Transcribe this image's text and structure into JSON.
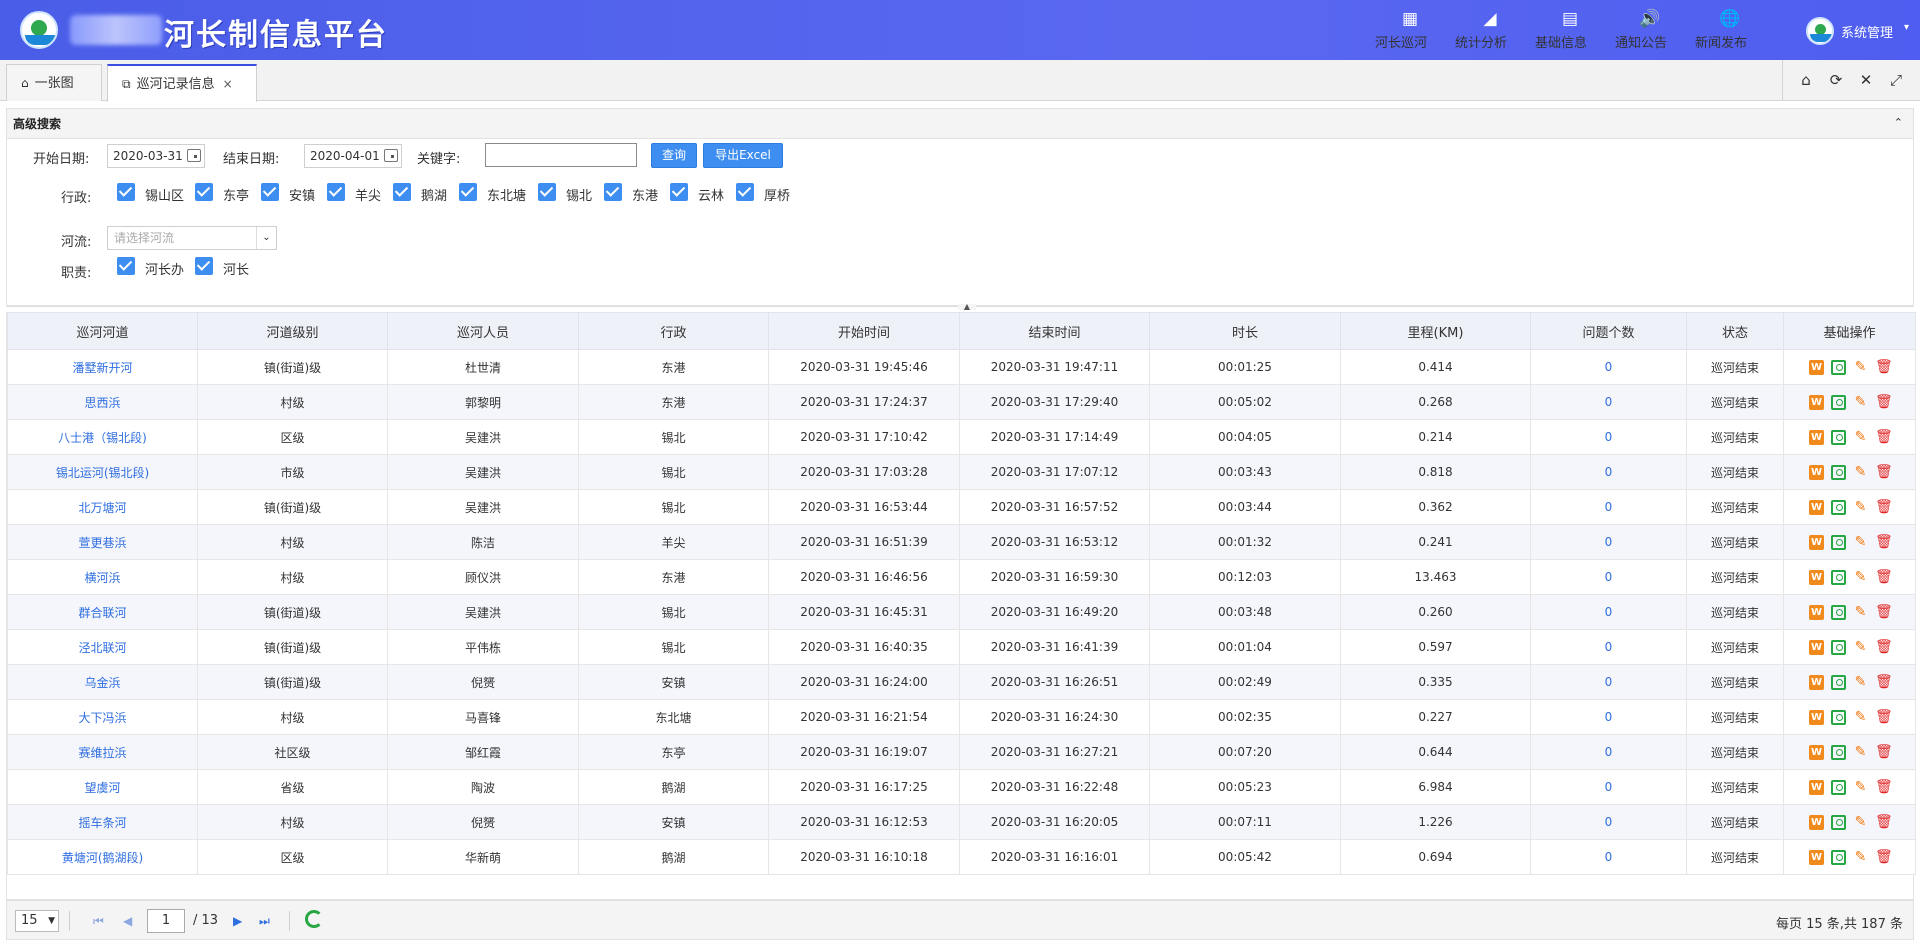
{
  "header": {
    "title": "河长制信息平台",
    "nav": [
      {
        "icon": "grid-table-icon",
        "glyph": "▦",
        "label": "河长巡河"
      },
      {
        "icon": "area-chart-icon",
        "glyph": "◢",
        "label": "统计分析"
      },
      {
        "icon": "id-card-icon",
        "glyph": "▤",
        "label": "基础信息"
      },
      {
        "icon": "speaker-icon",
        "glyph": "🔊",
        "label": "通知公告"
      },
      {
        "icon": "globe-icon",
        "glyph": "🌐",
        "label": "新闻发布"
      }
    ],
    "system_label": "系统管理"
  },
  "tabs": [
    {
      "icon": "home-icon",
      "label": "一张图"
    },
    {
      "icon": "window-icon",
      "label": "巡河记录信息",
      "close": "×"
    }
  ],
  "tools": [
    {
      "name": "home-tool-icon",
      "glyph": "⌂"
    },
    {
      "name": "refresh-tool-icon",
      "glyph": "⟳"
    },
    {
      "name": "close-tool-icon",
      "glyph": "✕"
    },
    {
      "name": "fullscreen-tool-icon",
      "glyph": "⤢"
    }
  ],
  "search": {
    "title": "高级搜索",
    "collapse_glyph": "⌃",
    "start_label": "开始日期:",
    "start_value": "2020-03-31",
    "end_label": "结束日期:",
    "end_value": "2020-04-01",
    "keyword_label": "关键字:",
    "keyword_value": "",
    "query_label": "查询",
    "export_label": "导出Excel",
    "admin_label": "行政:",
    "admin_options": [
      "锡山区",
      "东亭",
      "安镇",
      "羊尖",
      "鹅湖",
      "东北塘",
      "锡北",
      "东港",
      "云林",
      "厚桥"
    ],
    "river_label": "河流:",
    "river_placeholder": "请选择河流",
    "duty_label": "职责:",
    "duty_options": [
      "河长办",
      "河长"
    ]
  },
  "table": {
    "columns": [
      "巡河河道",
      "河道级别",
      "巡河人员",
      "行政",
      "开始时间",
      "结束时间",
      "时长",
      "里程(KM)",
      "问题个数",
      "状态",
      "基础操作"
    ],
    "rows": [
      [
        "潘墅新开河",
        "镇(街道)级",
        "杜世清",
        "东港",
        "2020-03-31 19:45:46",
        "2020-03-31 19:47:11",
        "00:01:25",
        "0.414",
        "0",
        "巡河结束"
      ],
      [
        "思西浜",
        "村级",
        "郭黎明",
        "东港",
        "2020-03-31 17:24:37",
        "2020-03-31 17:29:40",
        "00:05:02",
        "0.268",
        "0",
        "巡河结束"
      ],
      [
        "八士港（锡北段)",
        "区级",
        "吴建洪",
        "锡北",
        "2020-03-31 17:10:42",
        "2020-03-31 17:14:49",
        "00:04:05",
        "0.214",
        "0",
        "巡河结束"
      ],
      [
        "锡北运河(锡北段)",
        "市级",
        "吴建洪",
        "锡北",
        "2020-03-31 17:03:28",
        "2020-03-31 17:07:12",
        "00:03:43",
        "0.818",
        "0",
        "巡河结束"
      ],
      [
        "北万塘河",
        "镇(街道)级",
        "吴建洪",
        "锡北",
        "2020-03-31 16:53:44",
        "2020-03-31 16:57:52",
        "00:03:44",
        "0.362",
        "0",
        "巡河结束"
      ],
      [
        "萱更巷浜",
        "村级",
        "陈洁",
        "羊尖",
        "2020-03-31 16:51:39",
        "2020-03-31 16:53:12",
        "00:01:32",
        "0.241",
        "0",
        "巡河结束"
      ],
      [
        "横河浜",
        "村级",
        "顾仪洪",
        "东港",
        "2020-03-31 16:46:56",
        "2020-03-31 16:59:30",
        "00:12:03",
        "13.463",
        "0",
        "巡河结束"
      ],
      [
        "群合联河",
        "镇(街道)级",
        "吴建洪",
        "锡北",
        "2020-03-31 16:45:31",
        "2020-03-31 16:49:20",
        "00:03:48",
        "0.260",
        "0",
        "巡河结束"
      ],
      [
        "泾北联河",
        "镇(街道)级",
        "平伟栋",
        "锡北",
        "2020-03-31 16:40:35",
        "2020-03-31 16:41:39",
        "00:01:04",
        "0.597",
        "0",
        "巡河结束"
      ],
      [
        "乌金浜",
        "镇(街道)级",
        "倪赟",
        "安镇",
        "2020-03-31 16:24:00",
        "2020-03-31 16:26:51",
        "00:02:49",
        "0.335",
        "0",
        "巡河结束"
      ],
      [
        "大下冯浜",
        "村级",
        "马喜锋",
        "东北塘",
        "2020-03-31 16:21:54",
        "2020-03-31 16:24:30",
        "00:02:35",
        "0.227",
        "0",
        "巡河结束"
      ],
      [
        "赛维拉浜",
        "社区级",
        "邹红霞",
        "东亭",
        "2020-03-31 16:19:07",
        "2020-03-31 16:27:21",
        "00:07:20",
        "0.644",
        "0",
        "巡河结束"
      ],
      [
        "望虞河",
        "省级",
        "陶波",
        "鹅湖",
        "2020-03-31 16:17:25",
        "2020-03-31 16:22:48",
        "00:05:23",
        "6.984",
        "0",
        "巡河结束"
      ],
      [
        "摇车条河",
        "村级",
        "倪赟",
        "安镇",
        "2020-03-31 16:12:53",
        "2020-03-31 16:20:05",
        "00:07:11",
        "1.226",
        "0",
        "巡河结束"
      ],
      [
        "黄塘河(鹅湖段)",
        "区级",
        "华新萌",
        "鹅湖",
        "2020-03-31 16:10:18",
        "2020-03-31 16:16:01",
        "00:05:42",
        "0.694",
        "0",
        "巡河结束"
      ]
    ],
    "op_word_glyph": "W",
    "op_edit_glyph": "✎",
    "op_del_glyph": "🗑"
  },
  "pager": {
    "page_size": "15",
    "current_page": "1",
    "total_pages": "/ 13",
    "info": "每页 15 条,共 187 条"
  }
}
